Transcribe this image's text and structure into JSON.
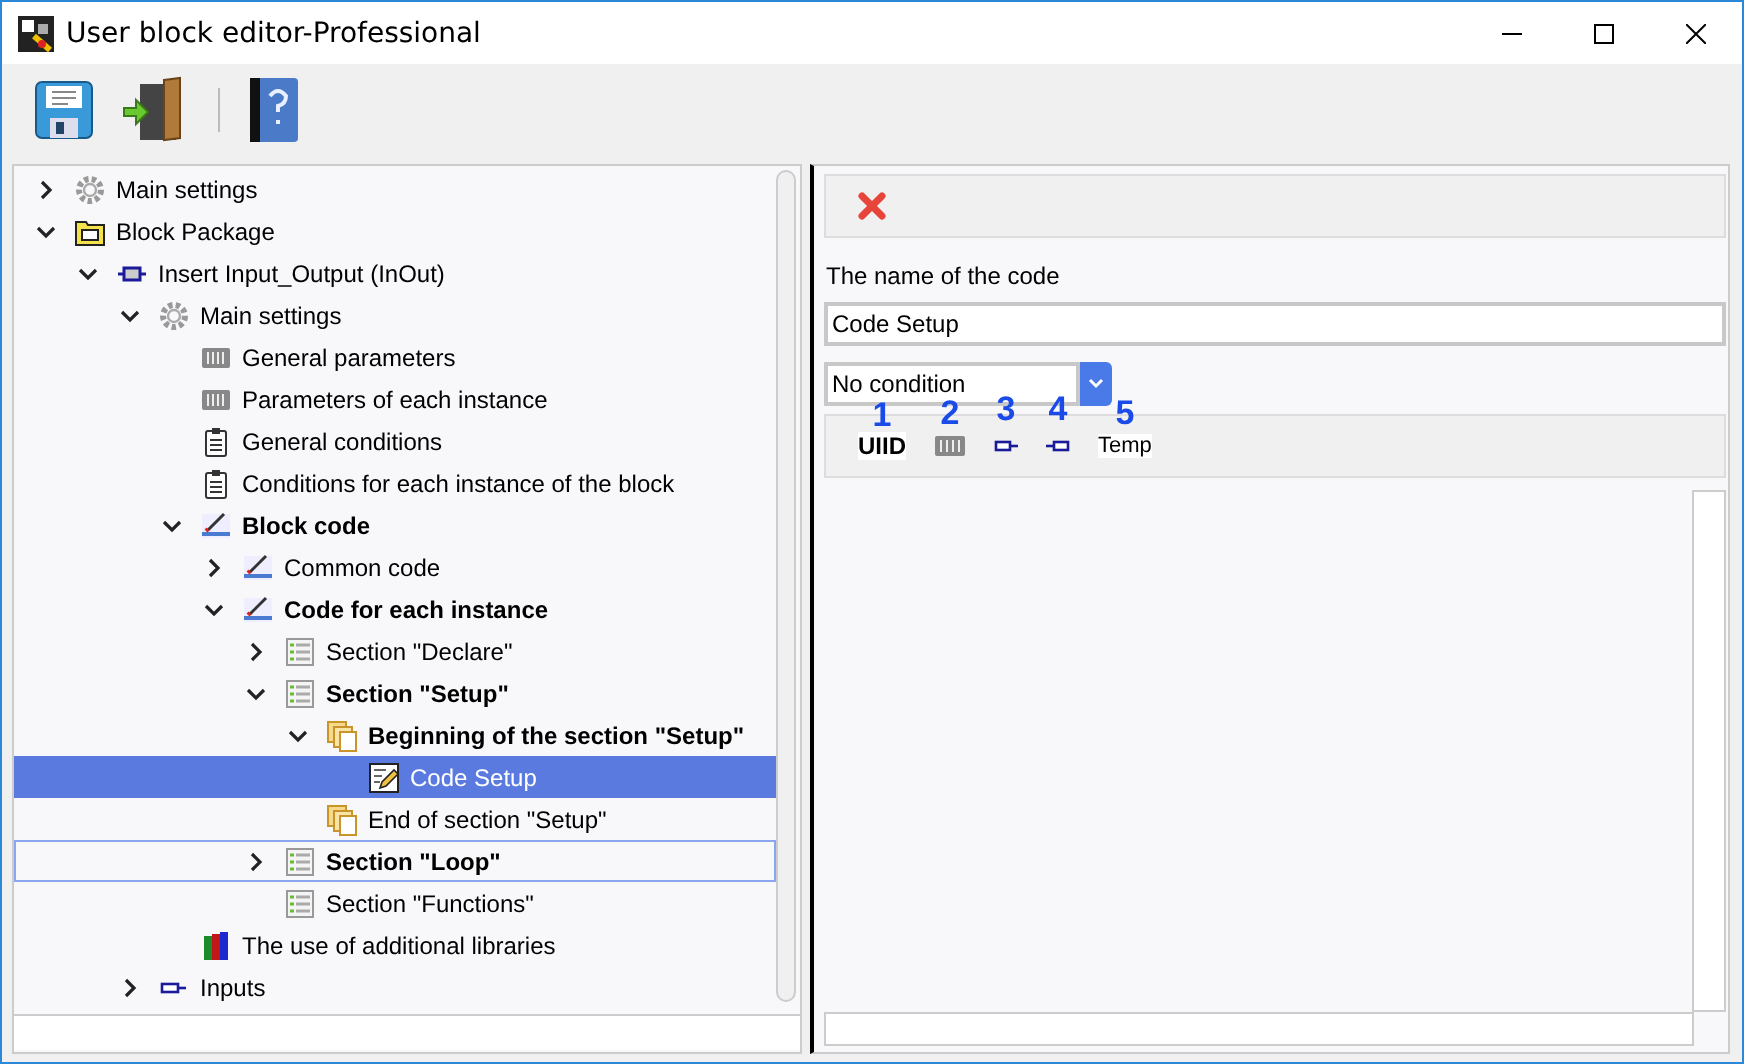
{
  "window": {
    "title": "User block editor-Professional"
  },
  "toolbar": [
    {
      "kind": "save"
    },
    {
      "kind": "exit"
    },
    {
      "kind": "help"
    }
  ],
  "tree": [
    {
      "label": "Main settings",
      "kind": "gear",
      "bold": false,
      "selected": false,
      "focused": false,
      "expanded": false
    },
    {
      "label": "Block Package",
      "kind": "package",
      "bold": false,
      "selected": false,
      "focused": false,
      "expanded": true,
      "children": [
        {
          "label": "Insert Input_Output (InOut)",
          "kind": "module",
          "bold": false,
          "selected": false,
          "focused": false,
          "expanded": true,
          "children": [
            {
              "label": "Main settings",
              "kind": "gear",
              "bold": false,
              "selected": false,
              "focused": false,
              "expanded": true,
              "children": [
                {
                  "label": "General parameters",
                  "kind": "params",
                  "bold": false,
                  "selected": false,
                  "focused": false
                },
                {
                  "label": "Parameters of each instance",
                  "kind": "params",
                  "bold": false,
                  "selected": false,
                  "focused": false
                },
                {
                  "label": "General conditions",
                  "kind": "clipboard",
                  "bold": false,
                  "selected": false,
                  "focused": false
                },
                {
                  "label": "Conditions for each instance of the block",
                  "kind": "clipboard",
                  "bold": false,
                  "selected": false,
                  "focused": false
                },
                {
                  "label": "Block code",
                  "kind": "code",
                  "bold": true,
                  "selected": false,
                  "focused": false,
                  "expanded": true,
                  "children": [
                    {
                      "label": "Common code",
                      "kind": "code",
                      "bold": false,
                      "selected": false,
                      "focused": false,
                      "expanded": false
                    },
                    {
                      "label": "Code for each instance",
                      "kind": "code",
                      "bold": true,
                      "selected": false,
                      "focused": false,
                      "expanded": true,
                      "children": [
                        {
                          "label": "Section \"Declare\"",
                          "kind": "list",
                          "bold": false,
                          "selected": false,
                          "focused": false,
                          "expanded": false
                        },
                        {
                          "label": "Section \"Setup\"",
                          "kind": "list",
                          "bold": true,
                          "selected": false,
                          "focused": false,
                          "expanded": true,
                          "children": [
                            {
                              "label": "Beginning of the section \"Setup\"",
                              "kind": "pages",
                              "bold": true,
                              "selected": false,
                              "focused": false,
                              "expanded": true,
                              "children": [
                                {
                                  "label": "Code Setup",
                                  "kind": "edit",
                                  "bold": false,
                                  "selected": true,
                                  "focused": false
                                }
                              ]
                            },
                            {
                              "label": "End of section \"Setup\"",
                              "kind": "pages",
                              "bold": false,
                              "selected": false,
                              "focused": false
                            }
                          ]
                        },
                        {
                          "label": "Section \"Loop\"",
                          "kind": "list",
                          "bold": true,
                          "selected": false,
                          "focused": true,
                          "expanded": false
                        },
                        {
                          "label": "Section \"Functions\"",
                          "kind": "list",
                          "bold": false,
                          "selected": false,
                          "focused": false
                        }
                      ]
                    }
                  ]
                },
                {
                  "label": "The use of additional libraries",
                  "kind": "books",
                  "bold": false,
                  "selected": false,
                  "focused": false
                }
              ]
            },
            {
              "label": "Inputs",
              "kind": "pin",
              "bold": false,
              "selected": false,
              "focused": false,
              "expanded": false
            }
          ]
        }
      ]
    }
  ],
  "editor": {
    "name_label": "The name of the code",
    "name_value": "Code Setup",
    "condition": "No condition",
    "insert_bar": [
      {
        "kind": "text",
        "label": "UIID",
        "bold": true,
        "marker": "1"
      },
      {
        "kind": "params",
        "marker": "2"
      },
      {
        "kind": "pin-out",
        "marker": "3"
      },
      {
        "kind": "pin-in",
        "marker": "4"
      },
      {
        "kind": "text",
        "label": "Temp",
        "bold": false,
        "marker": "5"
      }
    ]
  }
}
